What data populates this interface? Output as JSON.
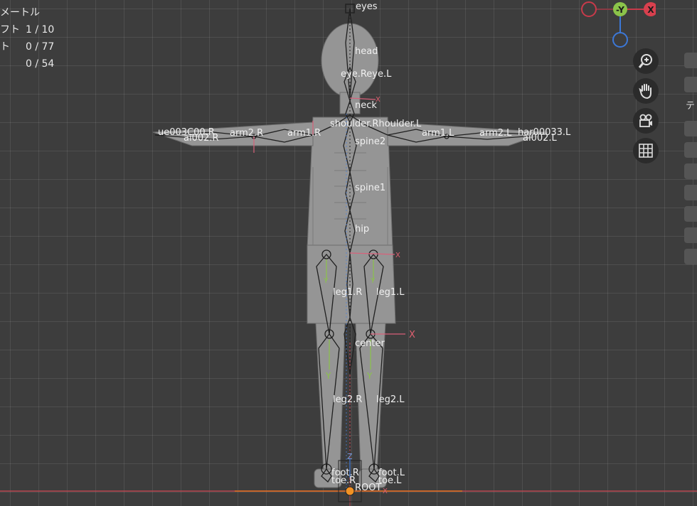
{
  "header": {
    "mode_label": "メートル"
  },
  "stats": [
    {
      "label": "フト",
      "value": "1 / 10"
    },
    {
      "label": "ト",
      "value": "0 / 77"
    },
    {
      "label": "",
      "value": "0 / 54"
    }
  ],
  "gizmo": {
    "neg_x": "",
    "neg_y": "-Y",
    "pos_x": "X",
    "z": ""
  },
  "axis_labels": {
    "x": "X",
    "y": "Y",
    "z": "Z"
  },
  "bones": {
    "eyes": "eyes",
    "head": "head",
    "eye_r_l": "eye.Reye.L",
    "neck": "neck",
    "shoulder": "shoulder.Rhoulder.L",
    "spine2": "spine2",
    "spine1": "spine1",
    "hip": "hip",
    "leg1_r": "leg1.R",
    "leg1_l": "leg1.L",
    "center": "center",
    "leg2_r": "leg2.R",
    "leg2_l": "leg2.L",
    "foot_r": "foot.R",
    "foot_l": "foot.L",
    "toe_r": "toe.R",
    "toe_l": "toe.L",
    "root": "ROOT",
    "arm2_r": "arm2.R",
    "arm1_r": "arm1.R",
    "arm1_l": "arm1.L",
    "arm2_l": "arm2.L",
    "hand_r_overlap": "ue003C00.R",
    "hand_l_overlap": "har00033.L",
    "ai002_r": "ai002.R",
    "ai002_l": "ai002.L"
  },
  "side_tab": "テ",
  "colors": {
    "x_axis": "#c83a4a",
    "y_axis": "#8bc34a",
    "z_axis": "#3c78d8",
    "bone": "#222222",
    "mesh": "#8e8e8e"
  },
  "tools": [
    "zoom-icon",
    "hand-icon",
    "camera-icon",
    "grid-icon"
  ]
}
